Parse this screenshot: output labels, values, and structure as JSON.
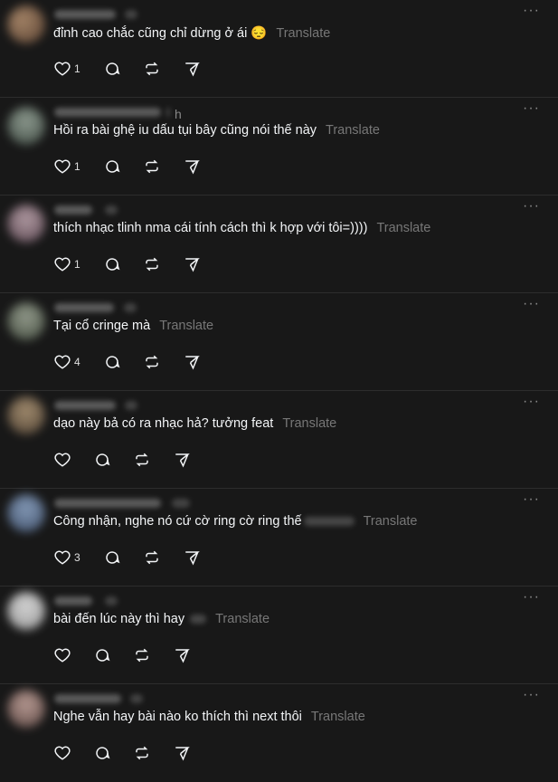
{
  "translate_label": "Translate",
  "more_label": "···",
  "colors": {
    "background": "#181818",
    "text": "#f3f5f7",
    "muted": "#777777",
    "divider": "#2d2d2d"
  },
  "posts": [
    {
      "text": "đỉnh cao chắc cũng chỉ dừng ở ái 😔",
      "likes": "1",
      "has_hidden": false,
      "time_hint": ""
    },
    {
      "text": "Hồi ra bài ghệ iu dấu tụi bây cũng nói thế này",
      "likes": "1",
      "has_hidden": false,
      "time_hint": "h"
    },
    {
      "text": "thích nhạc tlinh nma cái tính cách thì k hợp với tôi=))))",
      "likes": "1",
      "has_hidden": false,
      "time_hint": ""
    },
    {
      "text": "Tại cổ cringe mà",
      "likes": "4",
      "has_hidden": false,
      "time_hint": ""
    },
    {
      "text": "dạo này bả có ra nhạc hả? tưởng feat",
      "likes": "",
      "has_hidden": false,
      "time_hint": ""
    },
    {
      "text": "Công nhận, nghe nó cứ cờ ring cờ ring thế",
      "likes": "3",
      "has_hidden": true,
      "time_hint": ""
    },
    {
      "text": "bài đến lúc này thì hay",
      "likes": "",
      "has_hidden": true,
      "time_hint": ""
    },
    {
      "text": "Nghe vẫn hay bài nào ko thích thì next thôi",
      "likes": "",
      "has_hidden": false,
      "time_hint": ""
    }
  ]
}
